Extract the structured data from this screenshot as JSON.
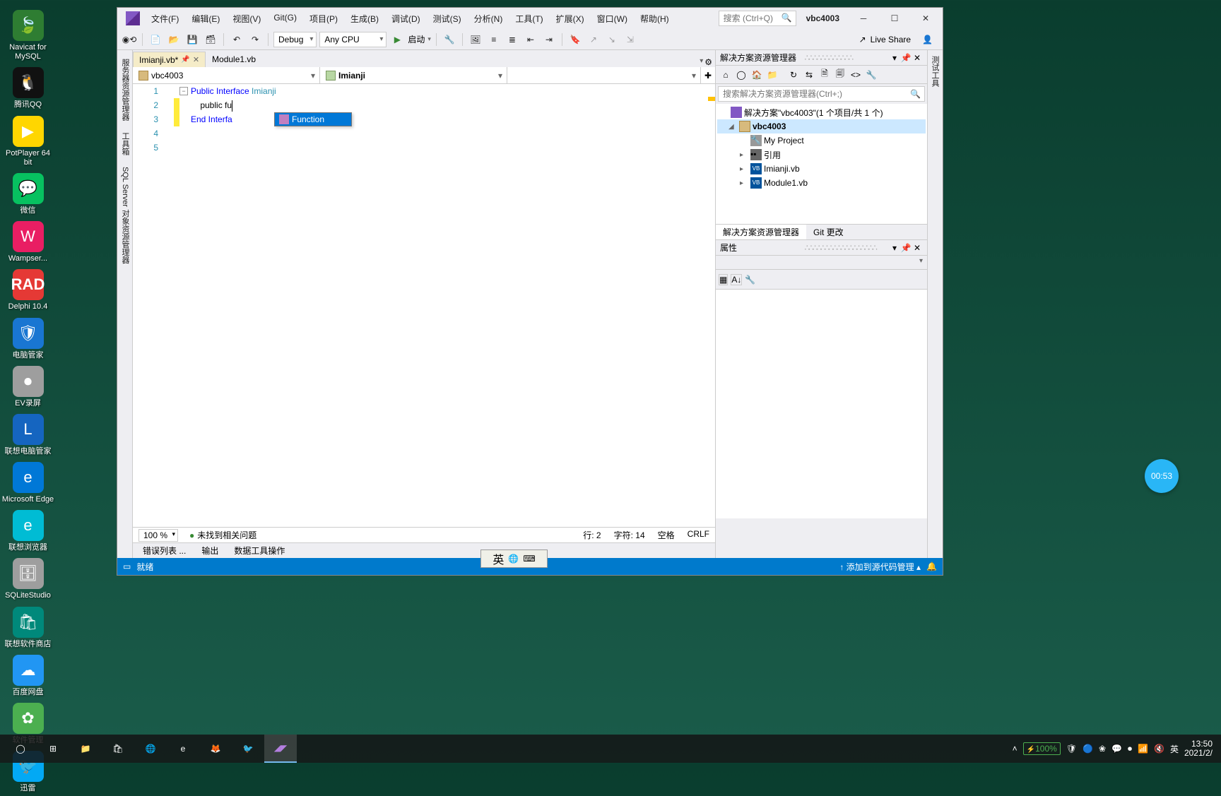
{
  "desktop_icons": [
    {
      "label": "Navicat for MySQL",
      "bg": "#2e7d32"
    },
    {
      "label": "腾讯QQ",
      "bg": "#111"
    },
    {
      "label": "PotPlayer 64 bit",
      "bg": "#ffd600"
    },
    {
      "label": "微信",
      "bg": "#07c160"
    },
    {
      "label": "Wampser...",
      "bg": "#e91e63"
    },
    {
      "label": "Delphi 10.4",
      "bg": "#e53935"
    },
    {
      "label": "电脑管家",
      "bg": "#1976d2"
    },
    {
      "label": "EV录屏",
      "bg": "#9e9e9e"
    },
    {
      "label": "联想电脑管家",
      "bg": "#1565c0"
    },
    {
      "label": "Microsoft Edge",
      "bg": "#0078d7"
    },
    {
      "label": "联想浏览器",
      "bg": "#00bcd4"
    },
    {
      "label": "SQLiteStudio",
      "bg": "#9e9e9e"
    },
    {
      "label": "联想软件商店",
      "bg": "#00897b"
    },
    {
      "label": "百度网盘",
      "bg": "#2196f3"
    },
    {
      "label": "软件管理",
      "bg": "#4caf50"
    },
    {
      "label": "迅雷",
      "bg": "#03a9f4"
    }
  ],
  "vs": {
    "menu": [
      "文件(F)",
      "编辑(E)",
      "视图(V)",
      "Git(G)",
      "项目(P)",
      "生成(B)",
      "调试(D)",
      "测试(S)",
      "分析(N)",
      "工具(T)",
      "扩展(X)",
      "窗口(W)",
      "帮助(H)"
    ],
    "search_placeholder": "搜索 (Ctrl+Q)",
    "project_name": "vbc4003",
    "toolbar": {
      "config": "Debug",
      "platform": "Any CPU",
      "start": "启动",
      "liveshare": "Live Share"
    },
    "tabs": [
      {
        "label": "Imianji.vb*",
        "active": true
      },
      {
        "label": "Module1.vb",
        "active": false
      }
    ],
    "nav": {
      "project": "vbc4003",
      "interface": "Imianji"
    },
    "code": {
      "lines": [
        1,
        2,
        3,
        4,
        5
      ],
      "l1_a": "Public Interface ",
      "l1_b": "Imianji",
      "l2_a": "    public ",
      "l2_b": "fu",
      "l3": "End Interfa",
      "intellisense": "Function"
    },
    "editor_status": {
      "zoom": "100 %",
      "issues": "未找到相关问题",
      "line": "行: 2",
      "col": "字符: 14",
      "ins": "空格",
      "enc": "CRLF"
    },
    "bottom_tabs": [
      "错误列表 ...",
      "输出",
      "数据工具操作"
    ],
    "sln": {
      "title": "解决方案资源管理器",
      "search_placeholder": "搜索解决方案资源管理器(Ctrl+;)",
      "root": "解决方案\"vbc4003\"(1 个项目/共 1 个)",
      "project": "vbc4003",
      "nodes": [
        "My Project",
        "引用",
        "Imianji.vb",
        "Module1.vb"
      ],
      "tabs": [
        "解决方案资源管理器",
        "Git 更改"
      ]
    },
    "props": {
      "title": "属性"
    },
    "vtools": [
      "服务器资源管理器",
      "工具箱",
      "SQL Server 对象资源管理器"
    ],
    "rvtools": [
      "测试工具"
    ],
    "status": {
      "ready": "就绪",
      "git": "添加到源代码管理"
    }
  },
  "ime": {
    "text": "英"
  },
  "timer": "00:53",
  "taskbar": {
    "battery": "100%",
    "lang": "英",
    "time": "13:50",
    "date": "2021/2/"
  }
}
